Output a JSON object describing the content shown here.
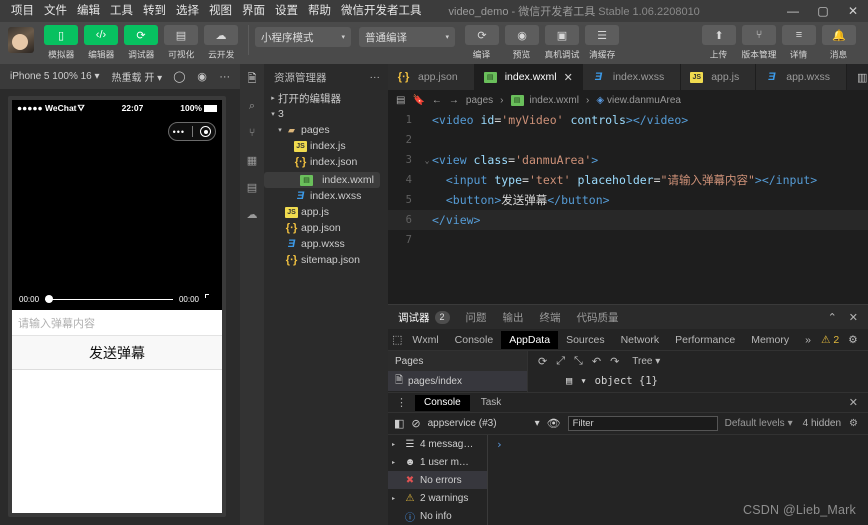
{
  "titlebar": {
    "menus": [
      "项目",
      "文件",
      "编辑",
      "工具",
      "转到",
      "选择",
      "视图",
      "界面",
      "设置",
      "帮助",
      "微信开发者工具"
    ],
    "window_title": "video_demo - 微信开发者工具 ",
    "version": "Stable 1.06.2208010",
    "minimize": "—",
    "maximize": "▢",
    "close": "✕"
  },
  "toolbar": {
    "buttons": [
      {
        "label": "模拟器",
        "icon": "phone-icon",
        "glyph": "▯",
        "green": true
      },
      {
        "label": "编辑器",
        "icon": "code-icon",
        "glyph": "‹/›",
        "green": true
      },
      {
        "label": "调试器",
        "icon": "bug-icon",
        "glyph": "⟳",
        "green": true
      },
      {
        "label": "可视化",
        "icon": "layout-icon",
        "glyph": "▤",
        "green": false
      },
      {
        "label": "云开发",
        "icon": "cloud-icon",
        "glyph": "☁",
        "green": false
      }
    ],
    "mode_select": "小程序模式",
    "compile_select": "普通编译",
    "mid_buttons": [
      {
        "label": "编译",
        "icon": "refresh-icon",
        "glyph": "⟳"
      },
      {
        "label": "预览",
        "icon": "qrcode-icon",
        "glyph": "◉"
      },
      {
        "label": "真机调试",
        "icon": "device-icon",
        "glyph": "▣"
      },
      {
        "label": "清缓存",
        "icon": "stack-icon",
        "glyph": "☰"
      }
    ],
    "right_buttons": [
      {
        "label": "上传",
        "icon": "upload-icon",
        "glyph": "⬆"
      },
      {
        "label": "版本管理",
        "icon": "branch-icon",
        "glyph": "⑂"
      },
      {
        "label": "详情",
        "icon": "list-icon",
        "glyph": "≡"
      },
      {
        "label": "消息",
        "icon": "bell-icon",
        "glyph": "🔔"
      }
    ],
    "caret": "▾"
  },
  "simulator": {
    "device_select": "iPhone 5 100% 16",
    "hotreload_select": "热重载 开",
    "icons": [
      "refresh-icon",
      "record-icon",
      "more-icon",
      "copy-icon"
    ],
    "status": {
      "carrier": "●●●●● WeChat",
      "wifi": "⛛",
      "time": "22:07",
      "battery_pct": "100%"
    },
    "capsule": {
      "dots": "•••",
      "circle": "circle-icon"
    },
    "video": {
      "current_time": "00:00",
      "duration": "00:00",
      "fullscreen": "fullscreen-icon"
    },
    "input_placeholder": "请输入弹幕内容",
    "send_button": "发送弹幕"
  },
  "explorer": {
    "strip_icons": [
      "files-icon",
      "search-icon",
      "source-control-icon",
      "extensions-icon",
      "debug-icon",
      "cloud-icon"
    ],
    "title": "资源管理器",
    "more": "···",
    "sections": [
      {
        "twisty": "▸",
        "label": "打开的编辑器",
        "indent": 0
      },
      {
        "twisty": "▾",
        "label": "3",
        "indent": 0
      }
    ],
    "tree": [
      {
        "twisty": "▾",
        "icon": "folder",
        "glyph": "▰",
        "label": "pages",
        "indent": 1,
        "selected": false
      },
      {
        "twisty": "",
        "icon": "js",
        "glyph": "JS",
        "label": "index.js",
        "indent": 2,
        "selected": false
      },
      {
        "twisty": "",
        "icon": "json",
        "glyph": "{∙}",
        "label": "index.json",
        "indent": 2,
        "selected": false
      },
      {
        "twisty": "",
        "icon": "wxml",
        "glyph": "▤",
        "label": "index.wxml",
        "indent": 2,
        "selected": true
      },
      {
        "twisty": "",
        "icon": "wxss",
        "glyph": "Ǝ",
        "label": "index.wxss",
        "indent": 2,
        "selected": false
      },
      {
        "twisty": "",
        "icon": "js",
        "glyph": "JS",
        "label": "app.js",
        "indent": 1,
        "selected": false
      },
      {
        "twisty": "",
        "icon": "json",
        "glyph": "{∙}",
        "label": "app.json",
        "indent": 1,
        "selected": false
      },
      {
        "twisty": "",
        "icon": "wxss",
        "glyph": "Ǝ",
        "label": "app.wxss",
        "indent": 1,
        "selected": false
      },
      {
        "twisty": "",
        "icon": "json",
        "glyph": "{∙}",
        "label": "sitemap.json",
        "indent": 1,
        "selected": false
      }
    ]
  },
  "editor": {
    "tabs": [
      {
        "label": "app.json",
        "icon": "json",
        "glyph": "{∙}",
        "active": false,
        "close": ""
      },
      {
        "label": "index.wxml",
        "icon": "wxml",
        "glyph": "▤",
        "active": true,
        "close": "✕"
      },
      {
        "label": "index.wxss",
        "icon": "wxss",
        "glyph": "Ǝ",
        "active": false,
        "close": ""
      },
      {
        "label": "app.js",
        "icon": "js",
        "glyph": "JS",
        "active": false,
        "close": ""
      },
      {
        "label": "app.wxss",
        "icon": "wxss",
        "glyph": "Ǝ",
        "active": false,
        "close": ""
      }
    ],
    "tabs_right": [
      "split-editor-icon",
      "more-actions-icon"
    ],
    "breadcrumb_icons": [
      "outline-icon",
      "bookmark-icon",
      "back-icon",
      "forward-icon"
    ],
    "breadcrumb": [
      "pages",
      "index.wxml",
      "view.danmuArea"
    ],
    "breadcrumb_sep": "›",
    "lines": [
      {
        "no": "1",
        "fold": "",
        "current": false,
        "tokens": [
          {
            "t": "tag",
            "v": "<video "
          },
          {
            "t": "attr",
            "v": "id"
          },
          {
            "t": "plain",
            "v": "="
          },
          {
            "t": "str",
            "v": "'myVideo'"
          },
          {
            "t": "attr",
            "v": " controls"
          },
          {
            "t": "tag",
            "v": "></video>"
          }
        ]
      },
      {
        "no": "2",
        "fold": "",
        "current": false,
        "tokens": []
      },
      {
        "no": "3",
        "fold": "⌄",
        "current": false,
        "tokens": [
          {
            "t": "tag",
            "v": "<view "
          },
          {
            "t": "attr",
            "v": "class"
          },
          {
            "t": "plain",
            "v": "="
          },
          {
            "t": "str",
            "v": "'danmuArea'"
          },
          {
            "t": "tag",
            "v": ">"
          }
        ]
      },
      {
        "no": "4",
        "fold": "",
        "current": false,
        "tokens": [
          {
            "t": "plain",
            "v": "  "
          },
          {
            "t": "tag",
            "v": "<input "
          },
          {
            "t": "attr",
            "v": "type"
          },
          {
            "t": "plain",
            "v": "="
          },
          {
            "t": "str",
            "v": "'text'"
          },
          {
            "t": "attr",
            "v": " placeholder"
          },
          {
            "t": "plain",
            "v": "="
          },
          {
            "t": "str",
            "v": "\"请输入弹幕内容\""
          },
          {
            "t": "tag",
            "v": "></input>"
          }
        ]
      },
      {
        "no": "5",
        "fold": "",
        "current": false,
        "tokens": [
          {
            "t": "plain",
            "v": "  "
          },
          {
            "t": "tag",
            "v": "<button>"
          },
          {
            "t": "txt",
            "v": "发送弹幕"
          },
          {
            "t": "tag",
            "v": "</button>"
          }
        ]
      },
      {
        "no": "6",
        "fold": "",
        "current": true,
        "tokens": [
          {
            "t": "tag",
            "v": "</view>"
          }
        ]
      },
      {
        "no": "7",
        "fold": "",
        "current": false,
        "tokens": []
      }
    ]
  },
  "debugger": {
    "top_tabs": [
      {
        "label": "调试器",
        "badge": "2",
        "active": true
      },
      {
        "label": "问题",
        "badge": "",
        "active": false
      },
      {
        "label": "输出",
        "badge": "",
        "active": false
      },
      {
        "label": "终端",
        "badge": "",
        "active": false
      },
      {
        "label": "代码质量",
        "badge": "",
        "active": false
      }
    ],
    "top_right": [
      "collapse-icon",
      "close-icon"
    ],
    "top_right_glyphs": [
      "⌃",
      "✕"
    ],
    "devtools_tabs": [
      {
        "label": "Wxml",
        "active": false
      },
      {
        "label": "Console",
        "active": false
      },
      {
        "label": "AppData",
        "active": true
      },
      {
        "label": "Sources",
        "active": false
      },
      {
        "label": "Network",
        "active": false
      },
      {
        "label": "Performance",
        "active": false
      },
      {
        "label": "Memory",
        "active": false
      },
      {
        "label": "»",
        "active": false
      }
    ],
    "inspect_icon": "inspect-icon",
    "warning_count": "2",
    "devtools_right_icons": [
      "gear-icon",
      "kebab-icon",
      "dock-icon"
    ],
    "appdata": {
      "pages_header": "Pages",
      "page_item": "pages/index",
      "tools": [
        "refresh-icon",
        "expand-icon",
        "collapse-icon",
        "undo-icon",
        "redo-icon"
      ],
      "tool_glyphs": [
        "⟳",
        "⤢",
        "⤡",
        "↶",
        "↷"
      ],
      "tree_mode": "Tree",
      "caret": "▾",
      "object_twisty": "▾",
      "object_value": "object {1}"
    },
    "drawer_tabs": [
      {
        "label": "Console",
        "active": true
      },
      {
        "label": "Task",
        "active": false
      }
    ],
    "drawer_close": "✕",
    "console": {
      "sidebar_toggle_icon": "sidebar-icon",
      "clear_icon": "clear-icon",
      "context": "appservice (#3)",
      "caret": "▾",
      "eye_icon": "eye-icon",
      "filter_placeholder": "Filter",
      "levels": "Default levels",
      "hidden_count": "4 hidden",
      "settings_icon": "gear-icon",
      "sidebar_rows": [
        {
          "twisty": "▸",
          "icon": "list-icon",
          "glyph": "☰",
          "label": "4 messag…",
          "color": "#cfcfcf",
          "hi": false
        },
        {
          "twisty": "▸",
          "icon": "user-icon",
          "glyph": "☻",
          "label": "1 user m…",
          "color": "#cfcfcf",
          "hi": false
        },
        {
          "twisty": "",
          "icon": "error-icon",
          "glyph": "✖",
          "label": "No errors",
          "color": "#e05252",
          "hi": true
        },
        {
          "twisty": "▸",
          "icon": "warning-icon",
          "glyph": "⚠",
          "label": "2 warnings",
          "color": "#e2b93d",
          "hi": false
        },
        {
          "twisty": "",
          "icon": "info-icon",
          "glyph": "ⓘ",
          "label": "No info",
          "color": "#4a9eff",
          "hi": false
        }
      ],
      "prompt": "›"
    }
  },
  "watermark": "CSDN @Lieb_Mark"
}
